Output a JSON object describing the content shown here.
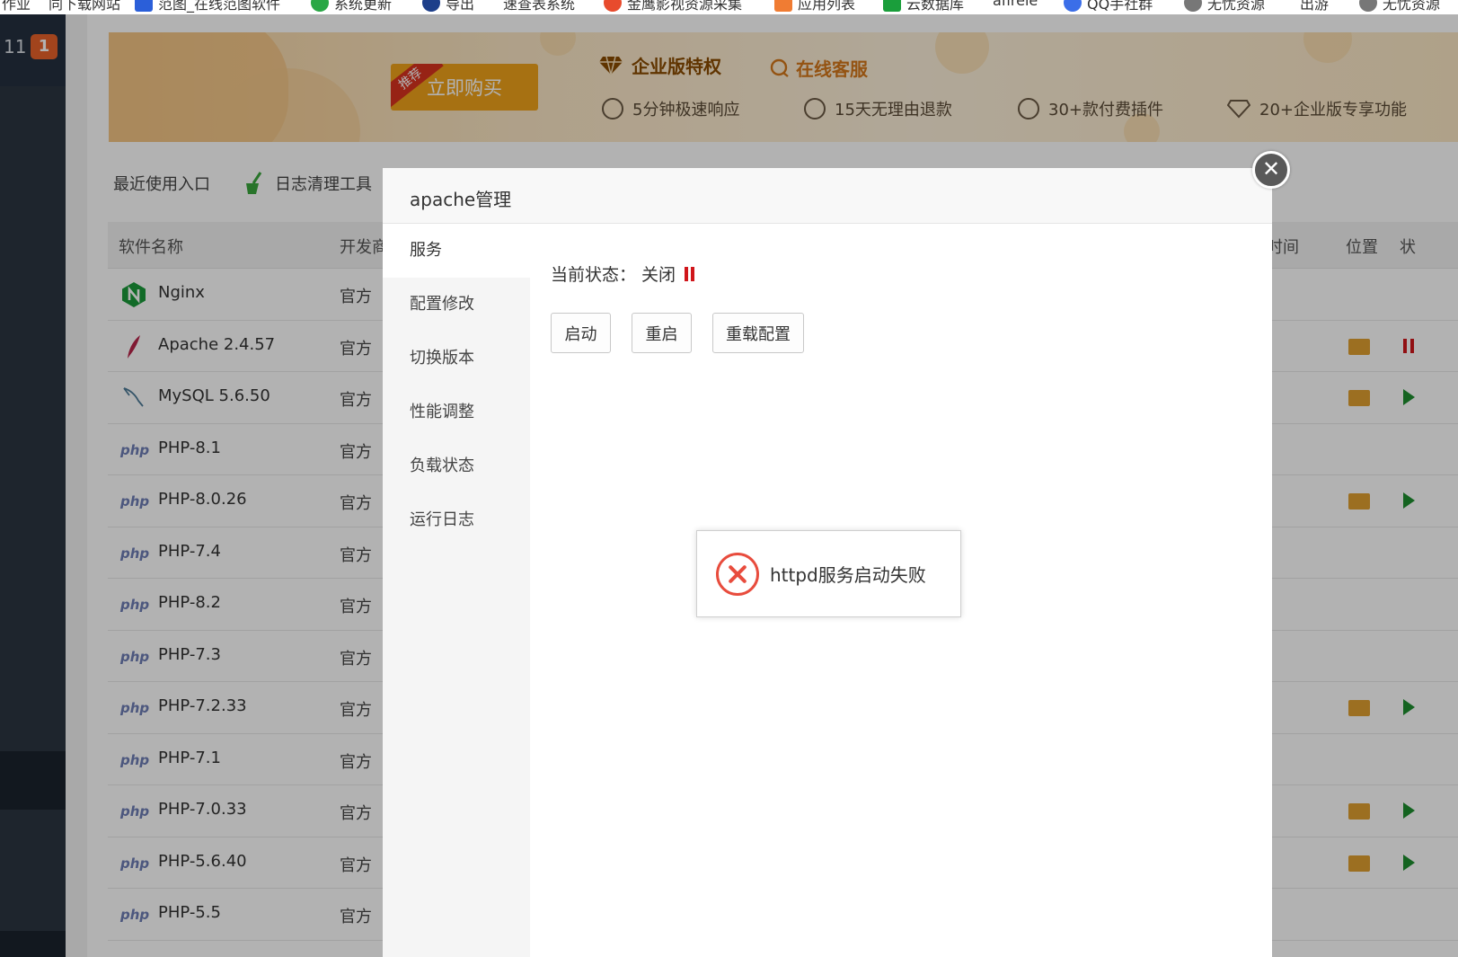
{
  "bookmarks": [
    {
      "label": "作业",
      "color": "#ffffff"
    },
    {
      "label": "同下载网站",
      "color": "#ffffff"
    },
    {
      "label": "范图_在线范图软件",
      "color": "#2b5fd9"
    },
    {
      "label": "系统更新",
      "color": "#29a745"
    },
    {
      "label": "导出",
      "color": "#1d3f8a"
    },
    {
      "label": "速查表系统",
      "color": "#ffffff"
    },
    {
      "label": "金鹰影视资源采集",
      "color": "#e84b2d"
    },
    {
      "label": "应用列表",
      "color": "#f07c33"
    },
    {
      "label": "云数据库",
      "color": "#1a9e3b"
    },
    {
      "label": "afirele",
      "color": "#ffffff"
    },
    {
      "label": "QQ手社群",
      "color": "#3b6ee8"
    },
    {
      "label": "无忧资源",
      "color": "#777777"
    },
    {
      "label": "出游",
      "color": "#ffffff"
    },
    {
      "label": "无忧资源",
      "color": "#777777"
    }
  ],
  "sidebar": {
    "counter": "11",
    "badge": "1"
  },
  "banner": {
    "buy_ribbon": "推荐",
    "buy_label": "立即购买",
    "enterprise_title": "企业版特权",
    "customer_service": "在线客服",
    "features": [
      "5分钟极速响应",
      "15天无理由退款",
      "30+款付费插件",
      "20+企业版专享功能"
    ]
  },
  "quick_links": {
    "recent": "最近使用入口",
    "log_clean": "日志清理工具"
  },
  "table": {
    "headers": {
      "name": "软件名称",
      "developer": "开发商",
      "time": "时间",
      "location": "位置",
      "status": "状"
    },
    "rows": [
      {
        "name": "Nginx",
        "developer": "官方",
        "icon": "nginx-icon",
        "folder": false,
        "state": "none"
      },
      {
        "name": "Apache 2.4.57",
        "developer": "官方",
        "icon": "apache-feather-icon",
        "folder": true,
        "state": "stopped"
      },
      {
        "name": "MySQL 5.6.50",
        "developer": "官方",
        "icon": "mysql-dolphin-icon",
        "folder": true,
        "state": "running"
      },
      {
        "name": "PHP-8.1",
        "developer": "官方",
        "icon": "php-icon",
        "folder": false,
        "state": "none"
      },
      {
        "name": "PHP-8.0.26",
        "developer": "官方",
        "icon": "php-icon",
        "folder": true,
        "state": "running"
      },
      {
        "name": "PHP-7.4",
        "developer": "官方",
        "icon": "php-icon",
        "folder": false,
        "state": "none"
      },
      {
        "name": "PHP-8.2",
        "developer": "官方",
        "icon": "php-icon",
        "folder": false,
        "state": "none"
      },
      {
        "name": "PHP-7.3",
        "developer": "官方",
        "icon": "php-icon",
        "folder": false,
        "state": "none"
      },
      {
        "name": "PHP-7.2.33",
        "developer": "官方",
        "icon": "php-icon",
        "folder": true,
        "state": "running"
      },
      {
        "name": "PHP-7.1",
        "developer": "官方",
        "icon": "php-icon",
        "folder": false,
        "state": "none"
      },
      {
        "name": "PHP-7.0.33",
        "developer": "官方",
        "icon": "php-icon",
        "folder": true,
        "state": "running"
      },
      {
        "name": "PHP-5.6.40",
        "developer": "官方",
        "icon": "php-icon",
        "folder": true,
        "state": "running"
      },
      {
        "name": "PHP-5.5",
        "developer": "官方",
        "icon": "php-icon",
        "folder": false,
        "state": "none"
      }
    ]
  },
  "dialog": {
    "title": "apache管理",
    "close_symbol": "✕",
    "nav": [
      "服务",
      "配置修改",
      "切换版本",
      "性能调整",
      "负载状态",
      "运行日志"
    ],
    "active_nav": "服务",
    "status_label": "当前状态：",
    "status_value": "关闭",
    "buttons": {
      "start": "启动",
      "restart": "重启",
      "reload": "重载配置"
    }
  },
  "toast": {
    "message": "httpd服务启动失败",
    "icon": "error-x-icon"
  },
  "colors": {
    "error": "#e84c3d",
    "stopped": "#d0161b",
    "running": "#1e8e2e",
    "folder": "#e0a030",
    "buy": "#f0a21a"
  }
}
